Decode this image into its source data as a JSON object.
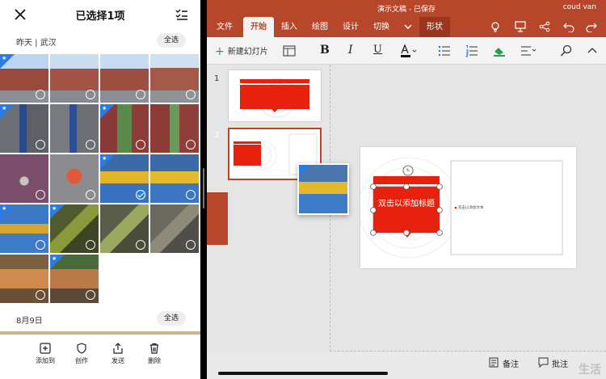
{
  "gallery": {
    "title": "已选择1项",
    "section1": {
      "label": "昨天 | 武汉",
      "select_all": "全选"
    },
    "section2": {
      "label": "8月9日",
      "select_all": "全选"
    },
    "actions": [
      {
        "label": "添加到",
        "icon": "add-to-icon"
      },
      {
        "label": "创作",
        "icon": "create-icon"
      },
      {
        "label": "发送",
        "icon": "share-icon"
      },
      {
        "label": "删除",
        "icon": "delete-icon"
      }
    ],
    "selected_count": 1
  },
  "ppt": {
    "doc_title": "演示文稿 - 已保存",
    "user": "coud van",
    "tabs": [
      "文件",
      "开始",
      "插入",
      "绘图",
      "设计",
      "切换",
      "形状"
    ],
    "active_tab": "开始",
    "new_slide": "新建幻灯片",
    "slides": [
      {
        "num": "1"
      },
      {
        "num": "2"
      }
    ],
    "active_slide": "2",
    "slide_title": "双击以添加标题",
    "slide_body": "双击以添加文本",
    "status": {
      "notes": "备注",
      "comments": "批注"
    },
    "watermark": "生活"
  },
  "colors": {
    "ppt_red": "#b7472a",
    "shape_red": "#e8210e",
    "select_blue": "#2a7be4"
  }
}
